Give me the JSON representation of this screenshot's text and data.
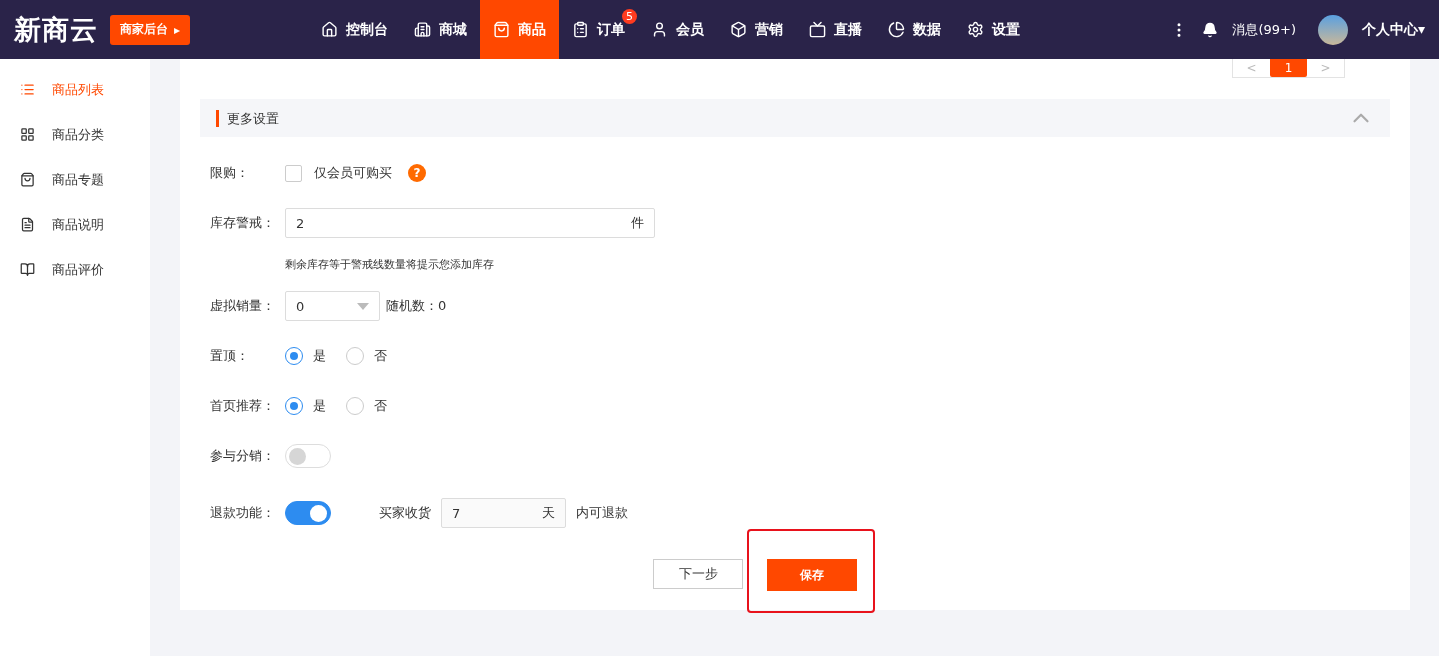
{
  "header": {
    "logo": "新商云",
    "backend_button": "商家后台",
    "backend_caret": "▸",
    "nav": [
      {
        "label": "控制台",
        "selected": false
      },
      {
        "label": "商城",
        "selected": false
      },
      {
        "label": "商品",
        "selected": true
      },
      {
        "label": "订单",
        "selected": false,
        "badge": "5"
      },
      {
        "label": "会员",
        "selected": false
      },
      {
        "label": "营销",
        "selected": false
      },
      {
        "label": "直播",
        "selected": false
      },
      {
        "label": "数据",
        "selected": false
      },
      {
        "label": "设置",
        "selected": false
      }
    ],
    "messages": "消息(99+)",
    "user": "个人中心",
    "user_caret": "▾"
  },
  "sidebar": {
    "items": [
      {
        "label": "商品列表",
        "selected": true
      },
      {
        "label": "商品分类",
        "selected": false
      },
      {
        "label": "商品专题",
        "selected": false
      },
      {
        "label": "商品说明",
        "selected": false
      },
      {
        "label": "商品评价",
        "selected": false
      }
    ]
  },
  "pagination": {
    "prev": "<",
    "next": ">",
    "pages": [
      {
        "label": "1",
        "selected": true
      }
    ]
  },
  "section": {
    "title": "更多设置",
    "expanded": true
  },
  "form": {
    "limit": {
      "label": "限购：",
      "option": "仅会员可购买",
      "checked": false,
      "help": "?"
    },
    "stock_alert": {
      "label": "库存警戒：",
      "value": "2",
      "unit": "件",
      "hint": "剩余库存等于警戒线数量将提示您添加库存"
    },
    "virtual_sales": {
      "label": "虚拟销量：",
      "value": "0",
      "random_label": "随机数：",
      "random_value": "0"
    },
    "pin_top": {
      "label": "置顶：",
      "options": [
        {
          "label": "是",
          "selected": true
        },
        {
          "label": "否",
          "selected": false
        }
      ]
    },
    "home_recommend": {
      "label": "首页推荐：",
      "options": [
        {
          "label": "是",
          "selected": true
        },
        {
          "label": "否",
          "selected": false
        }
      ]
    },
    "distribution": {
      "label": "参与分销：",
      "on": false
    },
    "refund": {
      "label": "退款功能：",
      "on": true,
      "prefix": "买家收货",
      "value": "7",
      "unit": "天",
      "suffix": "内可退款"
    }
  },
  "buttons": {
    "next": "下一步",
    "save": "保存",
    "save_highlighted": true
  }
}
